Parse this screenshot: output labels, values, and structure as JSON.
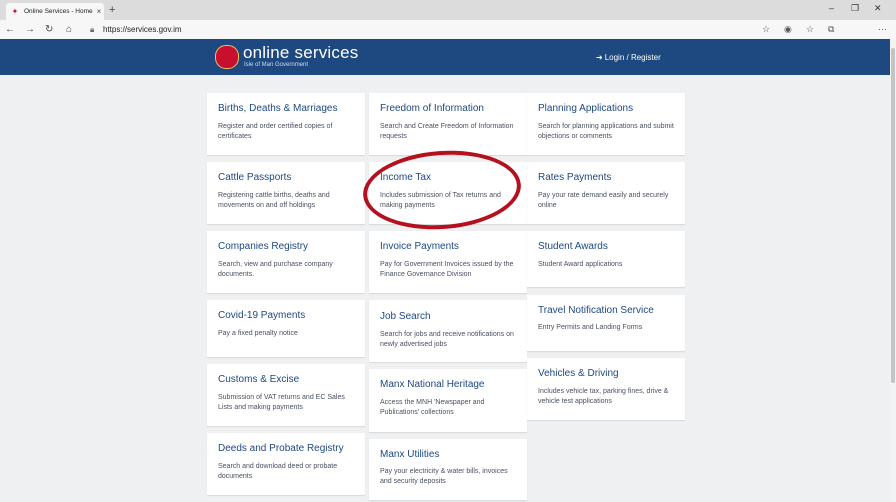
{
  "browser": {
    "tab_title": "Online Services - Home",
    "new_tab": "+",
    "url": "https://services.gov.im"
  },
  "header": {
    "brand_title": "online services",
    "brand_subtitle": "Isle of Man Government",
    "login_label": "Login / Register"
  },
  "cards": [
    {
      "title": "Births, Deaths & Marriages",
      "desc": "Register and order certified copies of certificates"
    },
    {
      "title": "Freedom of Information",
      "desc": "Search and Create Freedom of Information requests"
    },
    {
      "title": "Planning Applications",
      "desc": "Search for planning applications and submit objections or comments"
    },
    {
      "title": "Cattle Passports",
      "desc": "Registering cattle births, deaths and movements on and off holdings"
    },
    {
      "title": "Income Tax",
      "desc": "Includes submission of Tax returns and making payments"
    },
    {
      "title": "Rates Payments",
      "desc": "Pay your rate demand easily and securely online"
    },
    {
      "title": "Companies Registry",
      "desc": "Search, view and purchase company documents."
    },
    {
      "title": "Invoice Payments",
      "desc": "Pay for Government Invoices issued by the Finance Governance Division"
    },
    {
      "title": "Student Awards",
      "desc": "Student Award applications"
    },
    {
      "title": "Covid-19 Payments",
      "desc": "Pay a fixed penalty notice"
    },
    {
      "title": "Job Search",
      "desc": "Search for jobs and receive notifications on newly advertised jobs"
    },
    {
      "title": "Travel Notification Service",
      "desc": "Entry Permits and Landing Forms"
    },
    {
      "title": "Customs & Excise",
      "desc": "Submission of VAT returns and EC Sales Lists and making payments"
    },
    {
      "title": "Manx National Heritage",
      "desc": "Access the MNH 'Newspaper and Publications' collections"
    },
    {
      "title": "Vehicles & Driving",
      "desc": "Includes vehicle tax, parking fines, drive & vehicle test applications"
    },
    {
      "title": "Deeds and Probate Registry",
      "desc": "Search and download deed or probate documents"
    },
    {
      "title": "Manx Utilities",
      "desc": "Pay your electricity & water bills, invoices and security deposits"
    }
  ],
  "colors": {
    "header_bg": "#1e4880",
    "accent": "#1e4880",
    "highlight_ring": "#b4101e"
  }
}
